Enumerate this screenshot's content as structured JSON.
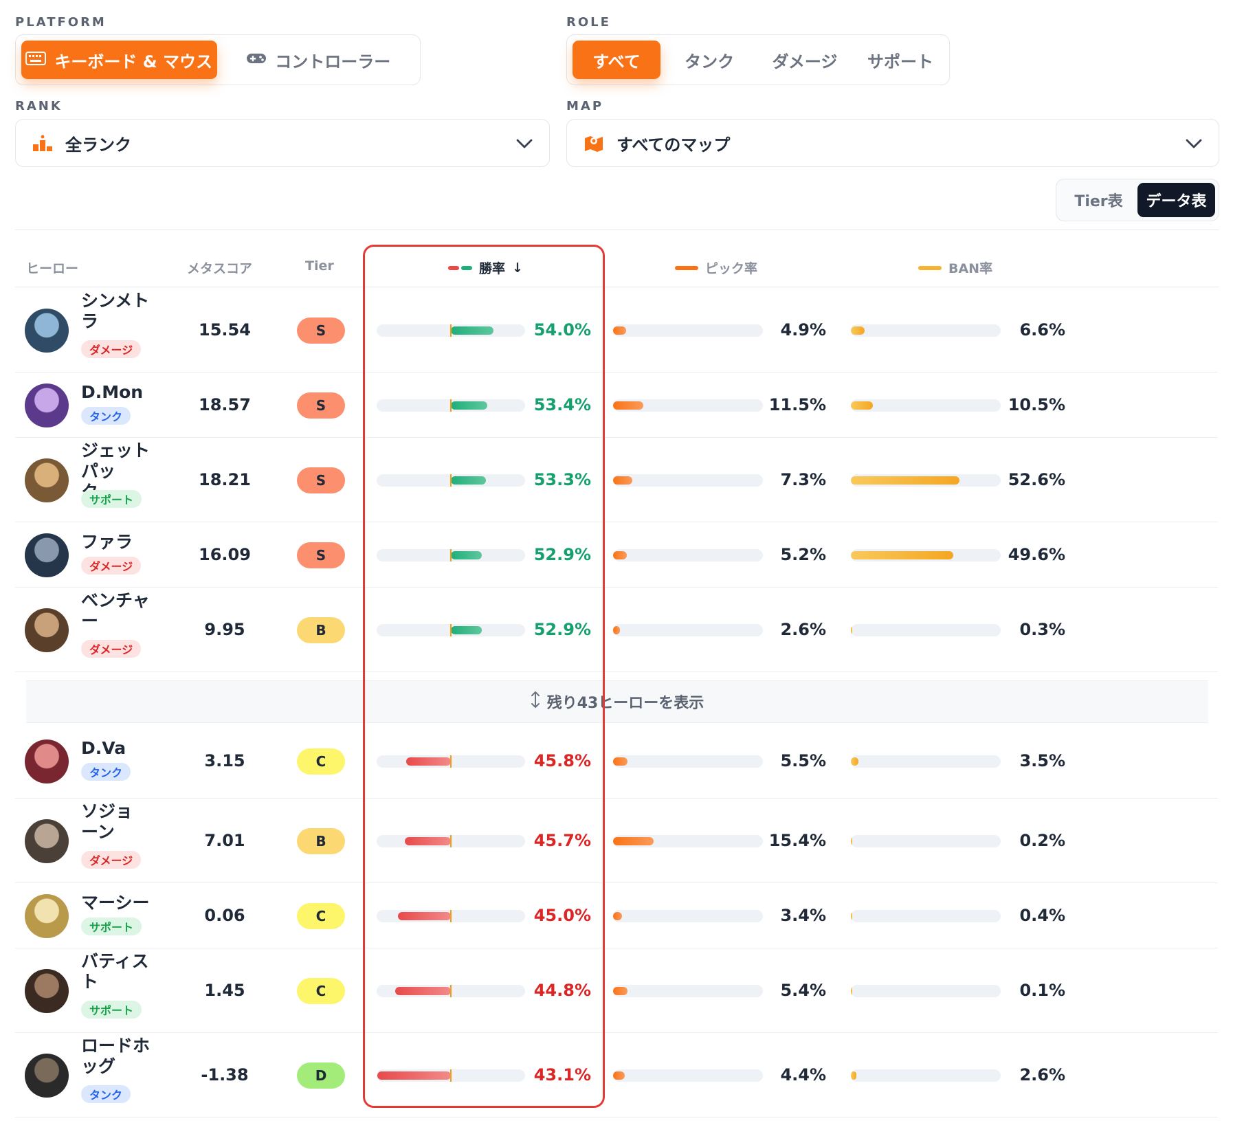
{
  "filters": {
    "platform": {
      "label": "PLATFORM",
      "options": [
        {
          "label": "キーボード & マウス",
          "icon": "keyboard-icon",
          "active": true
        },
        {
          "label": "コントローラー",
          "icon": "gamepad-icon",
          "active": false
        }
      ]
    },
    "role": {
      "label": "ROLE",
      "options": [
        {
          "label": "すべて",
          "active": true
        },
        {
          "label": "タンク",
          "active": false
        },
        {
          "label": "ダメージ",
          "active": false
        },
        {
          "label": "サポート",
          "active": false
        }
      ]
    },
    "rank": {
      "label": "RANK",
      "selected": "全ランク",
      "icon": "podium-icon"
    },
    "map": {
      "label": "MAP",
      "selected": "すべてのマップ",
      "icon": "map-icon"
    }
  },
  "view_toggle": {
    "tier_label": "Tier表",
    "data_label": "データ表",
    "active": "data"
  },
  "table": {
    "headers": {
      "hero": "ヒーロー",
      "meta_score": "メタスコア",
      "tier": "Tier",
      "win_rate": "勝率",
      "sort_indicator": "↓",
      "pick_rate": "ピック率",
      "ban_rate": "BAN率"
    },
    "top_rows": [
      {
        "name": "シンメトラ",
        "role": "ダメージ",
        "score": "15.54",
        "tier": "S",
        "win": "54.0%",
        "win_value": 54.0,
        "pick": "4.9%",
        "pick_value": 4.9,
        "ban": "6.6%",
        "ban_value": 6.6
      },
      {
        "name": "D.Mon",
        "role": "タンク",
        "score": "18.57",
        "tier": "S",
        "win": "53.4%",
        "win_value": 53.4,
        "pick": "11.5%",
        "pick_value": 11.5,
        "ban": "10.5%",
        "ban_value": 10.5
      },
      {
        "name": "ジェットパック...",
        "role": "サポート",
        "score": "18.21",
        "tier": "S",
        "win": "53.3%",
        "win_value": 53.3,
        "pick": "7.3%",
        "pick_value": 7.3,
        "ban": "52.6%",
        "ban_value": 52.6
      },
      {
        "name": "ファラ",
        "role": "ダメージ",
        "score": "16.09",
        "tier": "S",
        "win": "52.9%",
        "win_value": 52.9,
        "pick": "5.2%",
        "pick_value": 5.2,
        "ban": "49.6%",
        "ban_value": 49.6
      },
      {
        "name": "ベンチャー",
        "role": "ダメージ",
        "score": "9.95",
        "tier": "B",
        "win": "52.9%",
        "win_value": 52.9,
        "pick": "2.6%",
        "pick_value": 2.6,
        "ban": "0.3%",
        "ban_value": 0.3
      }
    ],
    "show_more": {
      "label": "残り43ヒーローを表示"
    },
    "bottom_rows": [
      {
        "name": "D.Va",
        "role": "タンク",
        "score": "3.15",
        "tier": "C",
        "win": "45.8%",
        "win_value": 45.8,
        "pick": "5.5%",
        "pick_value": 5.5,
        "ban": "3.5%",
        "ban_value": 3.5
      },
      {
        "name": "ソジョーン",
        "role": "ダメージ",
        "score": "7.01",
        "tier": "B",
        "win": "45.7%",
        "win_value": 45.7,
        "pick": "15.4%",
        "pick_value": 15.4,
        "ban": "0.2%",
        "ban_value": 0.2
      },
      {
        "name": "マーシー",
        "role": "サポート",
        "score": "0.06",
        "tier": "C",
        "win": "45.0%",
        "win_value": 45.0,
        "pick": "3.4%",
        "pick_value": 3.4,
        "ban": "0.4%",
        "ban_value": 0.4
      },
      {
        "name": "バティスト",
        "role": "サポート",
        "score": "1.45",
        "tier": "C",
        "win": "44.8%",
        "win_value": 44.8,
        "pick": "5.4%",
        "pick_value": 5.4,
        "ban": "0.1%",
        "ban_value": 0.1
      },
      {
        "name": "ロードホッグ",
        "role": "タンク",
        "score": "-1.38",
        "tier": "D",
        "win": "43.1%",
        "win_value": 43.1,
        "pick": "4.4%",
        "pick_value": 4.4,
        "ban": "2.6%",
        "ban_value": 2.6
      }
    ]
  },
  "colors": {
    "accent": "#f97316",
    "win_positive": "#15a06e",
    "win_negative": "#dc2626",
    "pick": "#f97316",
    "ban": "#f5b233",
    "highlight": "#e53935",
    "tier_S": "#fb8f6e",
    "tier_B": "#fcd873",
    "tier_C": "#fdf66b",
    "tier_D": "#a3ec7a"
  }
}
